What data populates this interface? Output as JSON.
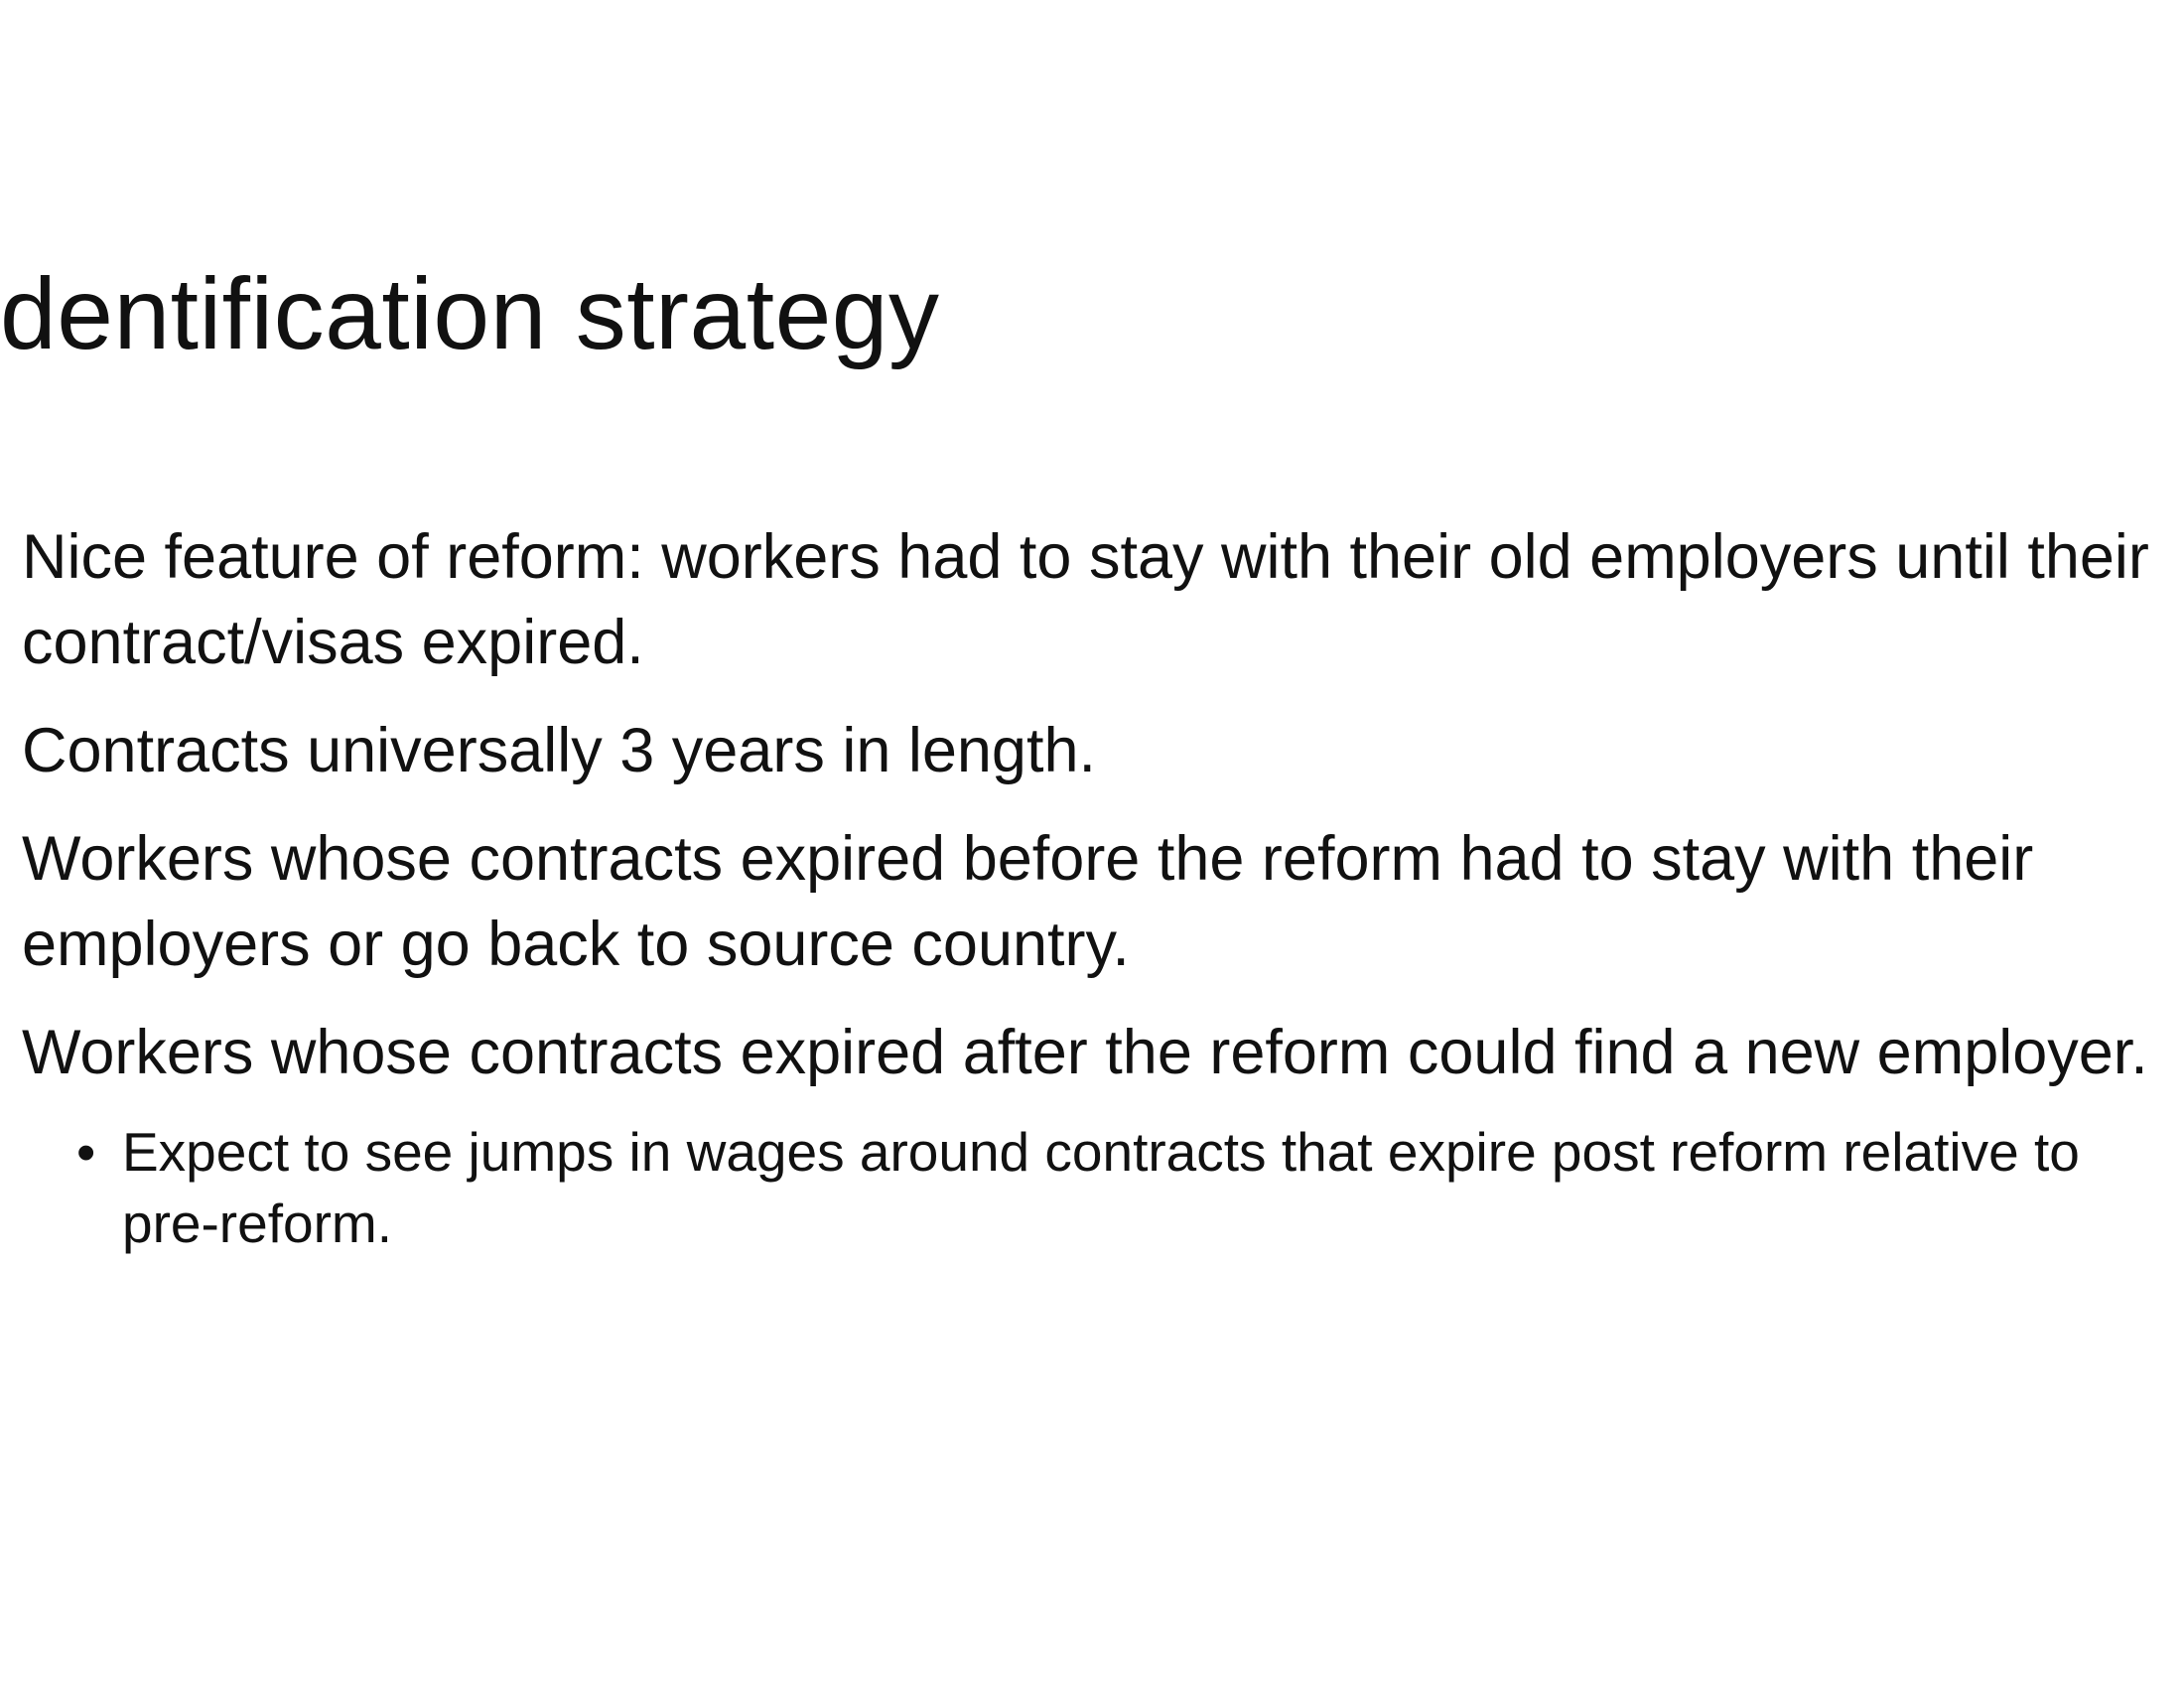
{
  "slide": {
    "title": "dentification strategy",
    "paragraphs": [
      "Nice feature of reform: workers had to stay with their old employers until their contract/visas expired.",
      "Contracts universally 3 years in length.",
      "Workers whose contracts expired before the reform had to stay with their employers or go back to source country.",
      "Workers whose contracts expired after the reform could find a new employer."
    ],
    "sub_bullets": [
      "Expect to see jumps in wages around contracts that expire post reform relative to pre-reform."
    ]
  },
  "icons": {
    "bullet": "bullet-dot-icon"
  }
}
